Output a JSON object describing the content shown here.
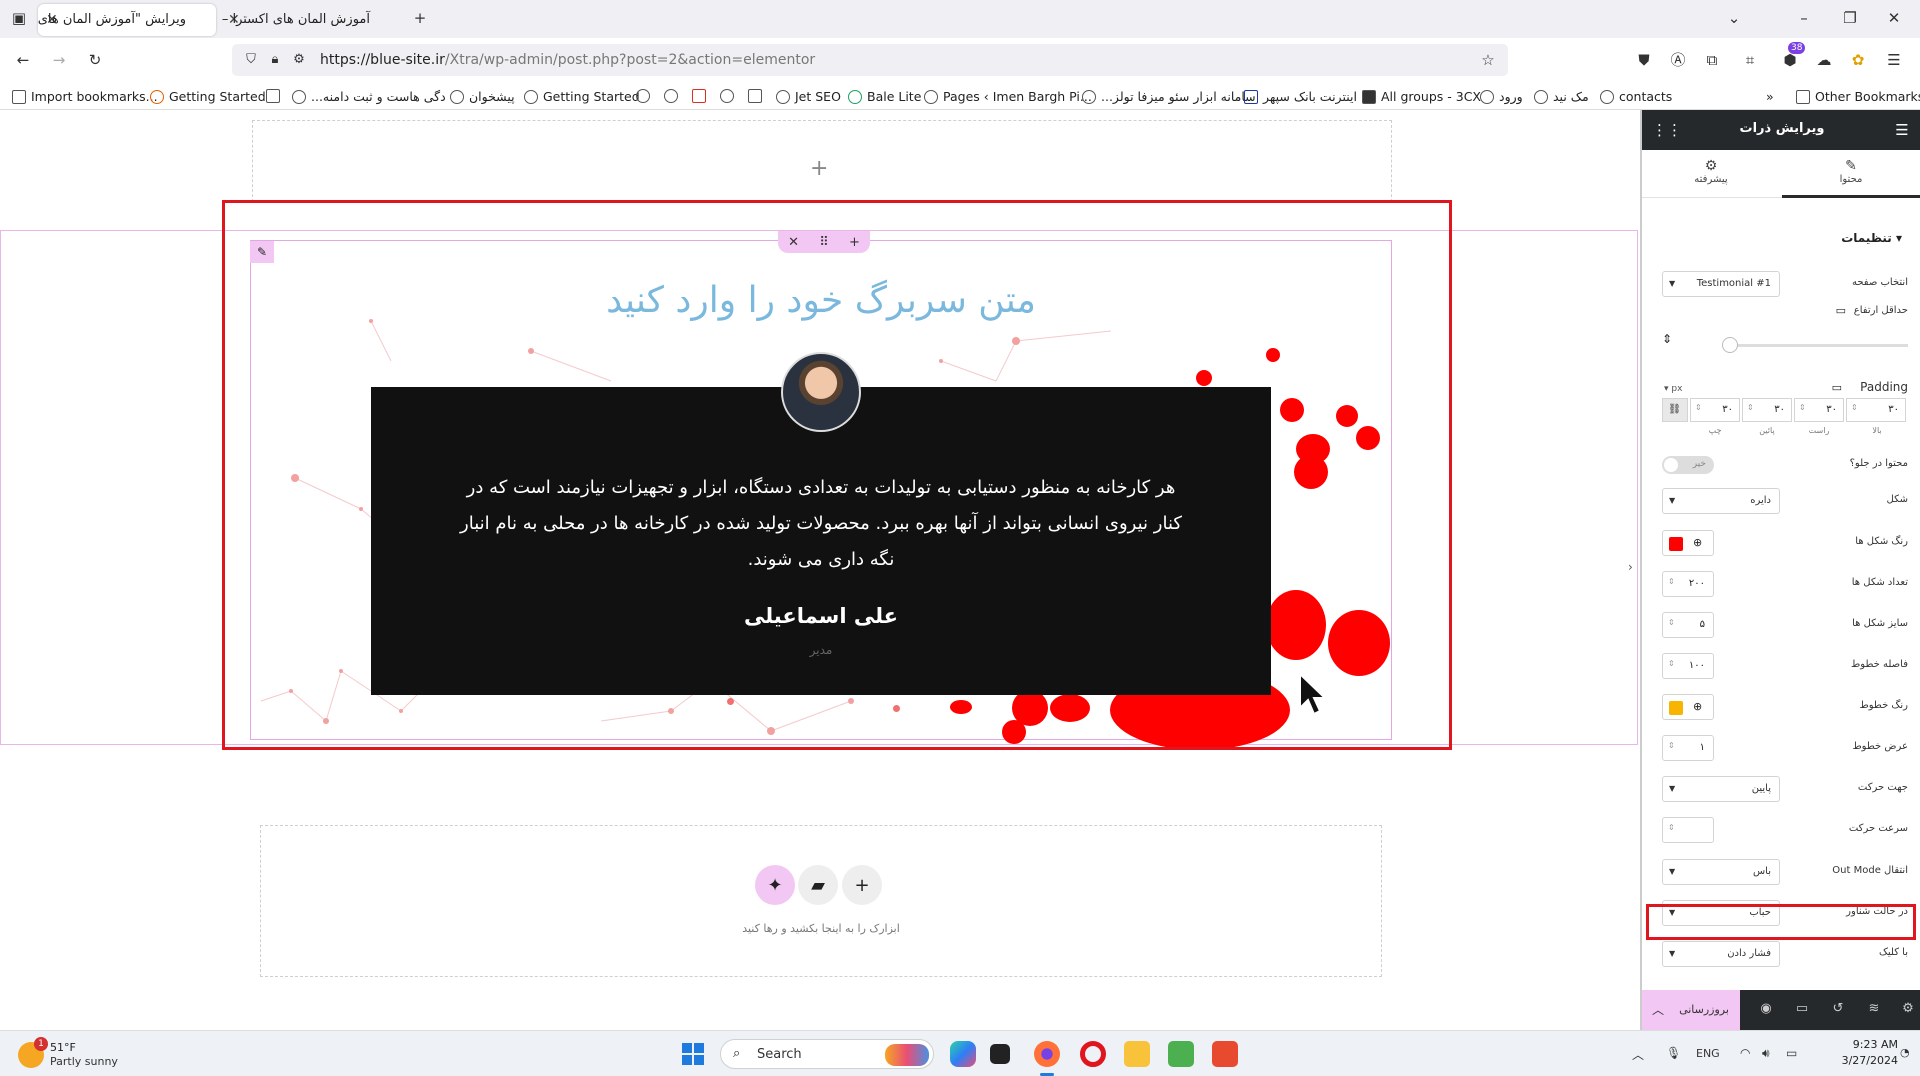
{
  "browser": {
    "tabs": [
      {
        "title": "ویرایش \"آموزش المان های اکسترا -",
        "active": true
      },
      {
        "title": "آموزش المان های اکسترا – علاءالدین",
        "active": false
      }
    ],
    "url_host": "https://blue-site.ir",
    "url_path": "/Xtra/wp-admin/post.php?post=2&action=elementor",
    "badge_count": "38",
    "bookmarks": [
      "Import bookmarks...",
      "Getting Started",
      "...دگی هاست و ثبت دامنه",
      "پیشخوان",
      "Getting Started",
      "Jet SEO",
      "Bale Lite",
      "Pages ‹ Imen Bargh Pi...",
      "...سامانه ابزار سئو میزفا تولز",
      "اینترنت بانک سپهر",
      "All groups - 3CX",
      "ورود",
      "مک نید",
      "contacts"
    ],
    "other_bookmarks": "Other Bookmarks"
  },
  "canvas": {
    "headline": "متن سربرگ خود را وارد کنید",
    "quote": "هر کارخانه به منظور دستیابی به تولیدات به تعدادی دستگاه، ابزار و تجهیزات نیازمند است که در کنار نیروی انسانی بتواند از آنها بهره ببرد. محصولات تولید شده در کارخانه ها در محلی به نام انبار نگه داری می شوند.",
    "person_name": "علی اسماعیلی",
    "person_role": "مدیر",
    "drop_hint": "ابزارک را به اینجا بکشید و رها کنید",
    "add_symbol": "+"
  },
  "panel": {
    "title": "ویرایش ذرات",
    "tab_content": "محتوا",
    "tab_advanced": "پیشرفته",
    "section": "تنظیمات",
    "rows": {
      "choose_page": {
        "label": "انتخاب صفحه",
        "value": "Testimonial #1"
      },
      "min_height": {
        "label": "حداقل ارتفاع"
      },
      "padding": {
        "label": "Padding",
        "unit": "px",
        "values": [
          "۳۰",
          "۳۰",
          "۳۰",
          "۳۰"
        ],
        "sides": [
          "بالا",
          "راست",
          "پائین",
          "چپ"
        ]
      },
      "content_in_column": {
        "label": "محتوا در جلو؟",
        "value": "خیر"
      },
      "shape": {
        "label": "شکل",
        "value": "دایره"
      },
      "shape_color": {
        "label": "رنگ شکل ها",
        "color": "#ff0000"
      },
      "shape_count": {
        "label": "تعداد شکل ها",
        "value": "۲۰۰"
      },
      "shape_size": {
        "label": "سایز شکل ها",
        "value": "۵"
      },
      "line_distance": {
        "label": "فاصله خطوط",
        "value": "۱۰۰"
      },
      "line_color": {
        "label": "رنگ خطوط",
        "color": "#f7b500"
      },
      "line_width": {
        "label": "عرض خطوط",
        "value": "۱"
      },
      "move_direction": {
        "label": "جهت حرکت",
        "value": "پایین"
      },
      "move_speed": {
        "label": "سرعت حرکت",
        "value": ""
      },
      "out_mode": {
        "label": "انتقال Out Mode",
        "value": "باس"
      },
      "hover_mode": {
        "label": "در حالت شناور",
        "value": "حباب"
      },
      "click_mode": {
        "label": "با کلیک",
        "value": "فشار دادن"
      }
    },
    "update_button": "بروزرسانی"
  },
  "taskbar": {
    "weather_temp": "51°F",
    "weather_cond": "Partly sunny",
    "weather_badge": "1",
    "search_placeholder": "Search",
    "lang": "ENG",
    "time": "9:23 AM",
    "date": "3/27/2024"
  },
  "colors": {
    "accent_red": "#e0161e",
    "elementor_pink": "#f3c7f3",
    "headline_blue": "#7ab8dd",
    "panel_dark": "#26292c"
  }
}
